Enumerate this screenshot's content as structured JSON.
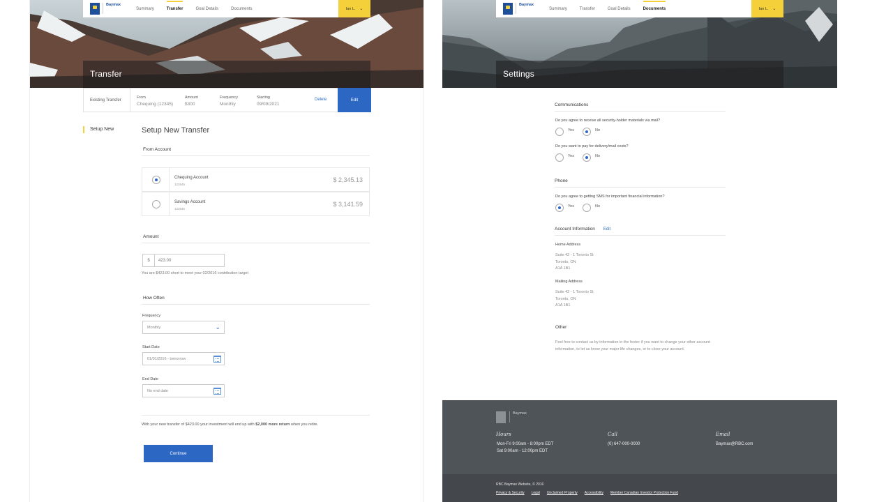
{
  "left": {
    "nav": {
      "brand": "Baymax",
      "items": [
        "Summary",
        "Transfer",
        "Goal Details",
        "Documents"
      ],
      "active": "Transfer",
      "user": "Ian L."
    },
    "title": "Transfer",
    "existing": {
      "label": "Existing Transfer",
      "from_h": "From",
      "from_v": "Chequing (12345)",
      "amount_h": "Amount",
      "amount_v": "$300",
      "freq_h": "Frequency",
      "freq_v": "Monthly",
      "start_h": "Starting",
      "start_v": "09/09/2021",
      "delete": "Delete",
      "edit": "Edit"
    },
    "side_label": "Setup New",
    "heading": "Setup New Transfer",
    "from_account": "From Account",
    "accounts": [
      {
        "name": "Chequing Account",
        "number": "123545",
        "balance": "$ 2,345.13",
        "selected": true
      },
      {
        "name": "Savings Account",
        "number": "123545",
        "balance": "$ 3,141.59",
        "selected": false
      }
    ],
    "amount_title": "Amount",
    "amount_currency": "$",
    "amount_value": "423.00",
    "amount_note": "You are $423.00 short to meet your 02/2016 contribution target",
    "how_often": "How Often",
    "frequency_label": "Frequency",
    "frequency_value": "Monthly",
    "start_label": "Start Date",
    "start_value": "01/01/2016 - tomorrow",
    "end_label": "End Date",
    "end_value": "No end date",
    "summary_pre": "With your new transfer of $423.00 your investment will end up with ",
    "summary_bold": "$2,000 more return",
    "summary_post": " when you retire.",
    "continue": "Continue"
  },
  "right": {
    "nav": {
      "brand": "Baymax",
      "items": [
        "Summary",
        "Transfer",
        "Goal Details",
        "Documents"
      ],
      "active": "Documents",
      "user": "Ian L."
    },
    "title": "Settings",
    "communications": "Communications",
    "q1": "Do you agree to receive all security-holder materials via mail?",
    "q2": "Do you want to pay for delivery/mail costs?",
    "phone": "Phone",
    "q3": "Do you agree to getting SMS for important financial information?",
    "yes": "Yes",
    "no": "No",
    "account_info": "Account Information",
    "account_edit": "Edit",
    "home_label": "Home Address",
    "home_lines": [
      "Suite 42 - 1 Toronto St",
      "Toronto, ON",
      "A1A 1B1"
    ],
    "mailing_label": "Mailing Address",
    "mailing_lines": [
      "Suite 42 - 1 Toronto St",
      "Toronto, ON",
      "A1A 1B1"
    ],
    "other": "Other",
    "other_text": "Feel free to contact us by information in the footer if you want to change your other account information, to let us know your major life changes, or to close your account.",
    "footer": {
      "brand": "Baymax",
      "hours_h": "Hours",
      "hours_1": "Mon-Fri  9:00am - 8:00pm EDT",
      "hours_2": "Sat  9:00am - 12:00pm EDT",
      "call_h": "Call",
      "call_v": "(0) 647-000-0000",
      "email_h": "Email",
      "email_v": "Baymax@RBC.com",
      "copyright": "RBC Baymax Website, © 2016",
      "links": [
        "Privacy & Security",
        "Legal",
        "Unclaimed Property",
        "Accessibility",
        "Member Canadian Investor Protection Fund"
      ]
    }
  }
}
